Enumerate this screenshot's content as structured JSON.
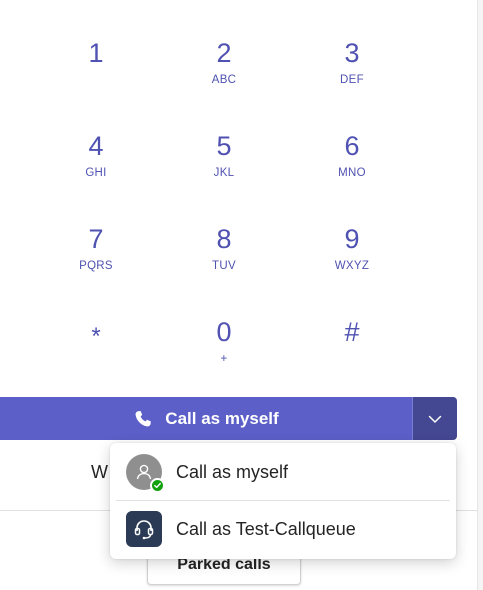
{
  "dialpad": {
    "keys": [
      {
        "digit": "1",
        "letters": ""
      },
      {
        "digit": "2",
        "letters": "ABC"
      },
      {
        "digit": "3",
        "letters": "DEF"
      },
      {
        "digit": "4",
        "letters": "GHI"
      },
      {
        "digit": "5",
        "letters": "JKL"
      },
      {
        "digit": "6",
        "letters": "MNO"
      },
      {
        "digit": "7",
        "letters": "PQRS"
      },
      {
        "digit": "8",
        "letters": "TUV"
      },
      {
        "digit": "9",
        "letters": "WXYZ"
      },
      {
        "digit": "*",
        "letters": ""
      },
      {
        "digit": "0",
        "letters": "+"
      },
      {
        "digit": "#",
        "letters": ""
      }
    ]
  },
  "call_button": {
    "label": "Call as myself",
    "icon": "phone-icon",
    "dropdown_icon": "chevron-down-icon"
  },
  "menu": {
    "items": [
      {
        "label": "Call as myself",
        "icon": "avatar-icon",
        "presence": "available"
      },
      {
        "label": "Call as Test-Callqueue",
        "icon": "headset-icon"
      }
    ]
  },
  "background": {
    "partial_text": "W",
    "parked_calls_label": "Parked calls"
  },
  "colors": {
    "accent": "#5b5fc7",
    "accent_dark": "#444791",
    "dial_text": "#4f52b2",
    "presence_available": "#13a10e"
  }
}
